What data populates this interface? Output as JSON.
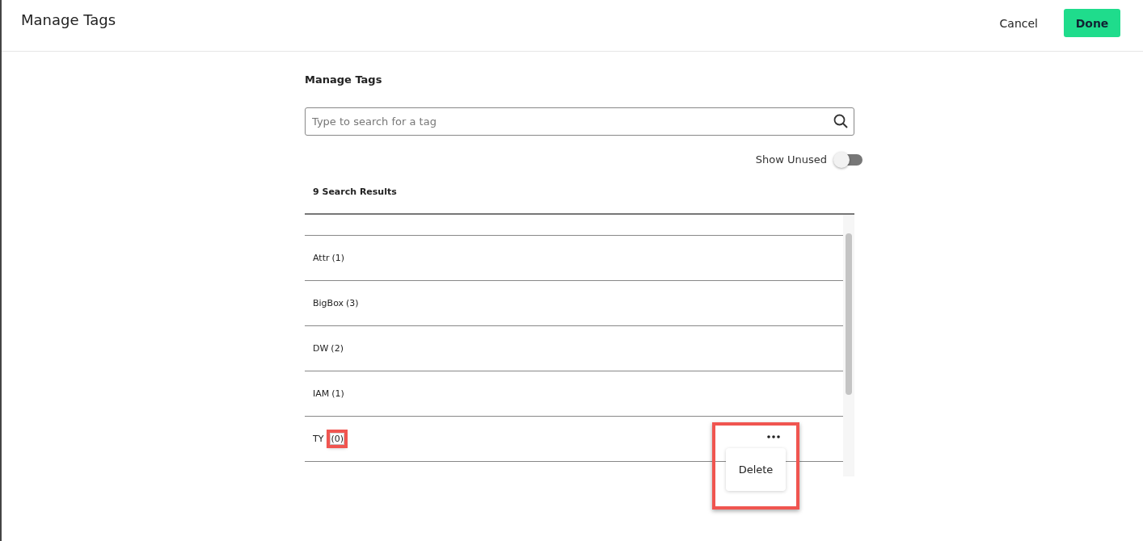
{
  "header": {
    "title": "Manage Tags",
    "cancel": "Cancel",
    "done": "Done"
  },
  "panel": {
    "heading": "Manage Tags",
    "search": {
      "placeholder": "Type to search for a tag"
    },
    "show_unused": {
      "label": "Show Unused",
      "on": false
    },
    "results_count": "9 Search Results",
    "tags": [
      {
        "name": "Attr",
        "count": "(1)",
        "highlighted": false,
        "menu_open": false
      },
      {
        "name": "BigBox",
        "count": "(3)",
        "highlighted": false,
        "menu_open": false
      },
      {
        "name": "DW",
        "count": "(2)",
        "highlighted": false,
        "menu_open": false
      },
      {
        "name": "IAM",
        "count": "(1)",
        "highlighted": false,
        "menu_open": false
      },
      {
        "name": "TY",
        "count": "(0)",
        "highlighted": true,
        "menu_open": true
      }
    ],
    "menu": {
      "items": [
        "Delete"
      ]
    }
  }
}
